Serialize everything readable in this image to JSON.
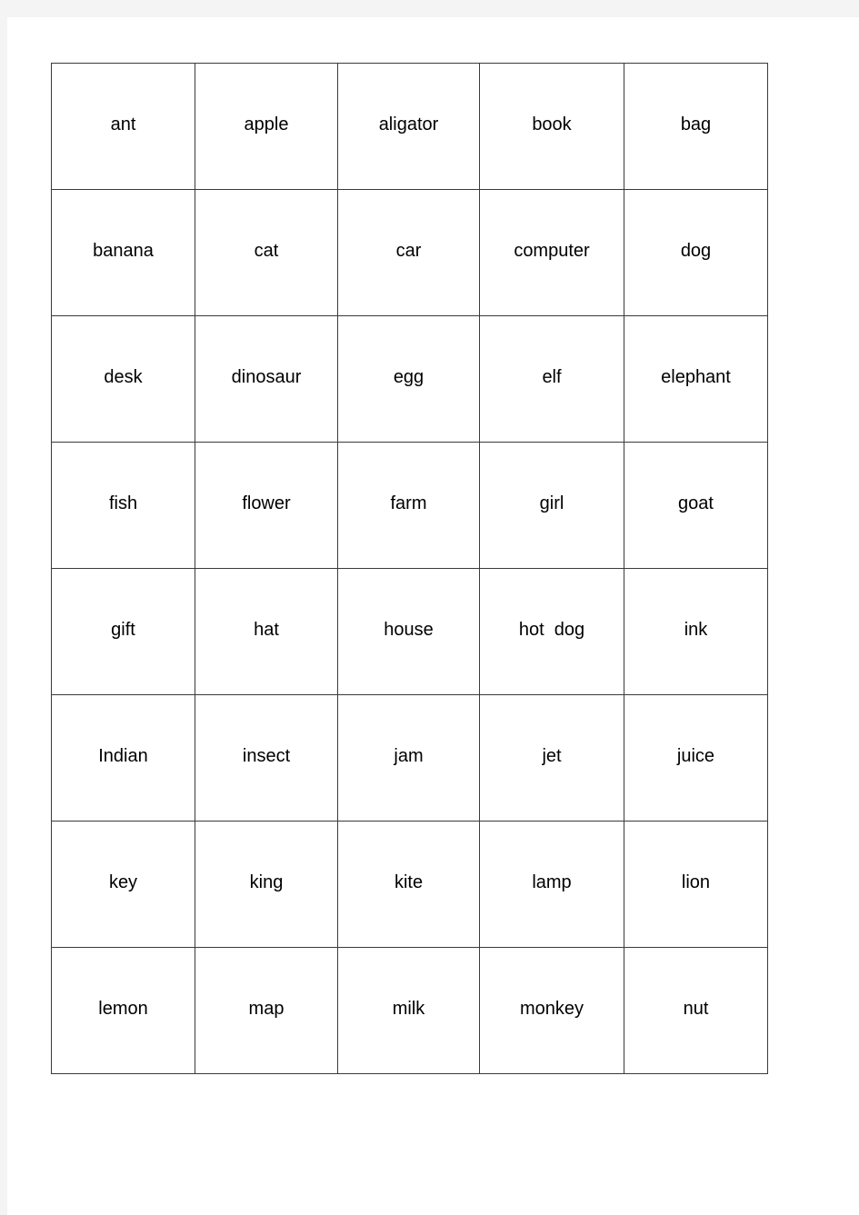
{
  "document": {
    "page_background": "#ffffff",
    "canvas_background": "#f4f4f4",
    "border_color": "#3a3a3a",
    "text_color": "#000000"
  },
  "table": {
    "columns": 5,
    "rows": 8,
    "cells": [
      [
        "ant",
        "apple",
        "aligator",
        "book",
        "bag"
      ],
      [
        "banana",
        "cat",
        "car",
        "computer",
        "dog"
      ],
      [
        "desk",
        "dinosaur",
        "egg",
        "elf",
        "elephant"
      ],
      [
        "fish",
        "flower",
        "farm",
        "girl",
        "goat"
      ],
      [
        "gift",
        "hat",
        "house",
        "hot  dog",
        "ink"
      ],
      [
        "Indian",
        "insect",
        "jam",
        "jet",
        "juice"
      ],
      [
        "key",
        "king",
        "kite",
        "lamp",
        "lion"
      ],
      [
        "lemon",
        "map",
        "milk",
        "monkey",
        "nut"
      ]
    ]
  }
}
